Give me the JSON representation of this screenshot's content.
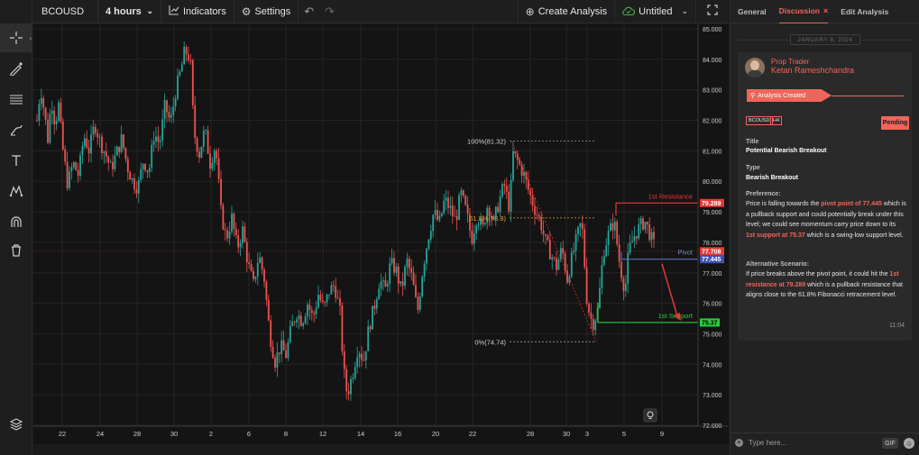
{
  "toolbar": {
    "symbol": "BCOUSD",
    "interval": "4 hours",
    "indicators": "Indicators",
    "settings": "Settings",
    "create_analysis": "Create Analysis",
    "untitled": "Untitled"
  },
  "left_tools": [
    "crosshair-icon",
    "brush-icon",
    "horizontal-lines-icon",
    "trendline-icon",
    "text-icon",
    "pattern-icon",
    "magnet-icon",
    "trash-icon",
    "layers-icon"
  ],
  "chart_data": {
    "type": "candlestick",
    "symbol": "BCOUSD",
    "y_ticks": [
      "85.000",
      "84.000",
      "83.000",
      "82.000",
      "81.000",
      "80.000",
      "79.000",
      "78.000",
      "77.000",
      "76.000",
      "75.000",
      "74.000",
      "73.000",
      "72.000"
    ],
    "ylim": [
      72.0,
      85.0
    ],
    "x_ticks": [
      "22",
      "24",
      "28",
      "30",
      "2",
      "6",
      "8",
      "12",
      "14",
      "16",
      "20",
      "22",
      "28",
      "30",
      "3",
      "5",
      "9"
    ],
    "series": [
      {
        "name": "price",
        "path": [
          [
            0,
            82.0
          ],
          [
            4,
            83.1
          ],
          [
            8,
            82.3
          ],
          [
            12,
            81.4
          ],
          [
            16,
            82.7
          ],
          [
            20,
            81.9
          ],
          [
            24,
            82.5
          ],
          [
            28,
            81.2
          ],
          [
            34,
            79.9
          ],
          [
            40,
            80.6
          ],
          [
            46,
            80.2
          ],
          [
            52,
            81.5
          ],
          [
            58,
            81.0
          ],
          [
            64,
            81.9
          ],
          [
            70,
            81.3
          ],
          [
            76,
            80.9
          ],
          [
            82,
            80.4
          ],
          [
            88,
            80.9
          ],
          [
            94,
            81.4
          ],
          [
            100,
            80.5
          ],
          [
            106,
            80.0
          ],
          [
            112,
            79.8
          ],
          [
            118,
            80.7
          ],
          [
            124,
            80.3
          ],
          [
            130,
            81.6
          ],
          [
            136,
            81.2
          ],
          [
            142,
            82.5
          ],
          [
            148,
            81.9
          ],
          [
            154,
            83.0
          ],
          [
            160,
            83.7
          ],
          [
            164,
            84.3
          ],
          [
            170,
            84.0
          ],
          [
            174,
            81.6
          ],
          [
            180,
            80.9
          ],
          [
            186,
            81.7
          ],
          [
            192,
            80.6
          ],
          [
            198,
            81.2
          ],
          [
            204,
            79.0
          ],
          [
            210,
            78.1
          ],
          [
            216,
            78.8
          ],
          [
            222,
            77.8
          ],
          [
            228,
            78.4
          ],
          [
            234,
            77.3
          ],
          [
            240,
            76.6
          ],
          [
            246,
            77.6
          ],
          [
            252,
            76.8
          ],
          [
            258,
            75.0
          ],
          [
            264,
            74.1
          ],
          [
            270,
            74.6
          ],
          [
            276,
            74.3
          ],
          [
            282,
            75.2
          ],
          [
            288,
            75.7
          ],
          [
            294,
            75.4
          ],
          [
            300,
            76.0
          ],
          [
            306,
            75.5
          ],
          [
            312,
            76.3
          ],
          [
            318,
            75.8
          ],
          [
            324,
            76.4
          ],
          [
            330,
            76.6
          ],
          [
            336,
            75.7
          ],
          [
            340,
            73.8
          ],
          [
            344,
            73.0
          ],
          [
            350,
            73.7
          ],
          [
            356,
            74.6
          ],
          [
            362,
            74.1
          ],
          [
            368,
            75.2
          ],
          [
            374,
            75.9
          ],
          [
            380,
            76.8
          ],
          [
            386,
            76.4
          ],
          [
            392,
            77.3
          ],
          [
            398,
            77.1
          ],
          [
            404,
            76.4
          ],
          [
            410,
            77.4
          ],
          [
            416,
            76.8
          ],
          [
            422,
            75.7
          ],
          [
            428,
            77.2
          ],
          [
            434,
            78.2
          ],
          [
            440,
            79.0
          ],
          [
            446,
            78.6
          ],
          [
            452,
            79.4
          ],
          [
            458,
            79.1
          ],
          [
            464,
            78.7
          ],
          [
            470,
            79.6
          ],
          [
            476,
            79.0
          ],
          [
            482,
            78.1
          ],
          [
            488,
            78.9
          ],
          [
            494,
            78.4
          ],
          [
            500,
            79.3
          ],
          [
            506,
            78.6
          ],
          [
            512,
            79.3
          ],
          [
            518,
            79.9
          ],
          [
            524,
            79.1
          ],
          [
            528,
            80.9
          ],
          [
            534,
            80.6
          ],
          [
            540,
            80.2
          ],
          [
            546,
            79.6
          ],
          [
            552,
            79.1
          ],
          [
            558,
            78.7
          ],
          [
            564,
            78.0
          ],
          [
            570,
            77.6
          ],
          [
            576,
            77.2
          ],
          [
            582,
            77.8
          ],
          [
            588,
            76.8
          ],
          [
            594,
            77.6
          ],
          [
            600,
            78.3
          ],
          [
            604,
            78.7
          ],
          [
            610,
            76.0
          ],
          [
            616,
            75.3
          ],
          [
            622,
            75.8
          ],
          [
            628,
            77.7
          ],
          [
            634,
            78.3
          ],
          [
            640,
            78.7
          ],
          [
            646,
            77.3
          ],
          [
            652,
            76.4
          ],
          [
            656,
            77.7
          ],
          [
            662,
            78.2
          ],
          [
            668,
            78.5
          ],
          [
            674,
            78.7
          ],
          [
            678,
            78.4
          ],
          [
            684,
            77.9
          ]
        ]
      }
    ],
    "annotations": {
      "fib_top": "100%(81.32)",
      "fib_mid": "61.8%(78.8)",
      "fib_bottom": "0%(74.74)",
      "resistance_label": "1st Resistance",
      "pivot_label": "Pivot",
      "support_label": "1st Support",
      "resistance_value": "79.289",
      "price_value": "77.708",
      "pivot_value": "77.445",
      "support_value": "75.37"
    },
    "levels": {
      "fib_top": 81.32,
      "fib_mid": 78.8,
      "fib_bottom": 74.74,
      "resistance": 79.289,
      "price": 77.708,
      "pivot": 77.445,
      "support": 75.37
    },
    "colors": {
      "up": "#26a69a",
      "down": "#ef5350",
      "resistance": "#e53935",
      "pivot": "#5c6bc0",
      "support": "#2ecc40",
      "fib": "#e0a030"
    }
  },
  "panel": {
    "tabs": [
      "General",
      "Discussion",
      "Edit Analysis"
    ],
    "active_tab": "Discussion",
    "date": "JANUARY 8, 2024",
    "role": "Prop Trader",
    "author": "Ketan Rameshchandra",
    "banner": "Analysis Created",
    "tags": [
      "BCOUSD",
      "H4"
    ],
    "status": "Pending",
    "title_label": "Title",
    "title_value": "Potential Bearish Breakout",
    "type_label": "Type",
    "type_value": "Bearish Breakout",
    "pref_label": "Preference:",
    "pref_1": "Price is falling towards the ",
    "pref_hl1": "pivot point of 77.445",
    "pref_2": " which is a pullback support and could potentially break under this level; we could see momentum carry price down to its ",
    "pref_hl2": "1st support at 75.37",
    "pref_3": " which is a swing-low support level.",
    "alt_label": "Alternative Scenario:",
    "alt_1": "If price breaks above the pivot point, it could hit the ",
    "alt_hl": "1st resistance at 79.289",
    "alt_2": " which is a pullback resistance that aligns close to the 61.8% Fibonacci retracement level.",
    "time": "11:04",
    "reply_placeholder": "Type here...",
    "gif": "GIF"
  }
}
